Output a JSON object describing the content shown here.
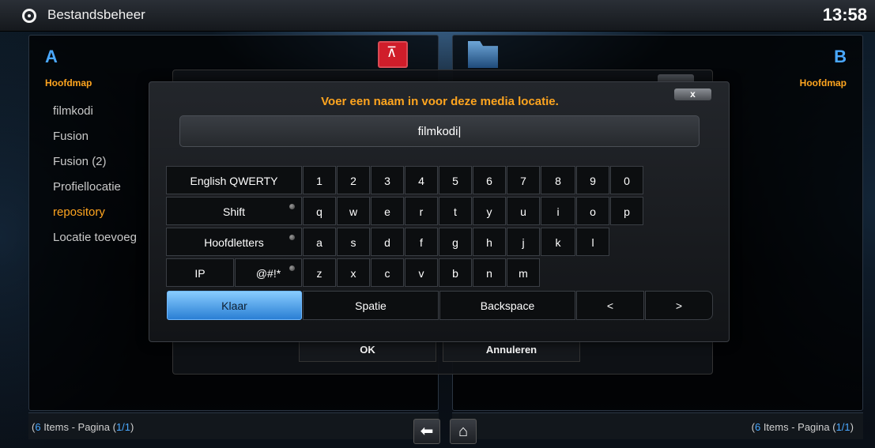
{
  "header": {
    "title": "Bestandsbeheer",
    "time": "13:58"
  },
  "left_panel": {
    "letter": "A",
    "path": "Hoofdmap",
    "items": [
      {
        "label": "filmkodi"
      },
      {
        "label": "Fusion"
      },
      {
        "label": "Fusion (2)"
      },
      {
        "label": "Profiellocatie"
      },
      {
        "label": "repository",
        "active": true
      },
      {
        "label": "Locatie toevoeg"
      }
    ],
    "footer": {
      "count": "6",
      "text_mid": " Items - Pagina (",
      "page": "1/1",
      "close": ")"
    }
  },
  "right_panel": {
    "letter": "B",
    "path": "Hoofdmap",
    "footer": {
      "count": "6",
      "text_mid": " Items - Pagina (",
      "page": "1/1",
      "close": ")"
    }
  },
  "under_dialog": {
    "ok_label": "OK",
    "cancel_label": "Annuleren"
  },
  "keyboard": {
    "heading": "Voer een naam in voor deze media locatie.",
    "close_label": "x",
    "input_value": "filmkodi|",
    "layout_label": "English QWERTY",
    "shift_label": "Shift",
    "caps_label": "Hoofdletters",
    "ip_label": "IP",
    "symbols_label": "@#!*",
    "row1": [
      "1",
      "2",
      "3",
      "4",
      "5",
      "6",
      "7",
      "8",
      "9",
      "0"
    ],
    "row2": [
      "q",
      "w",
      "e",
      "r",
      "t",
      "y",
      "u",
      "i",
      "o",
      "p"
    ],
    "row3": [
      "a",
      "s",
      "d",
      "f",
      "g",
      "h",
      "j",
      "k",
      "l"
    ],
    "row4": [
      "z",
      "x",
      "c",
      "v",
      "b",
      "n",
      "m"
    ],
    "done_label": "Klaar",
    "space_label": "Spatie",
    "backspace_label": "Backspace",
    "left_label": "<",
    "right_label": ">"
  },
  "icons": {
    "back": "back-arrow-icon",
    "home": "home-icon"
  },
  "colors": {
    "accent_orange": "#ffa51f",
    "accent_blue": "#4aa8ff"
  }
}
